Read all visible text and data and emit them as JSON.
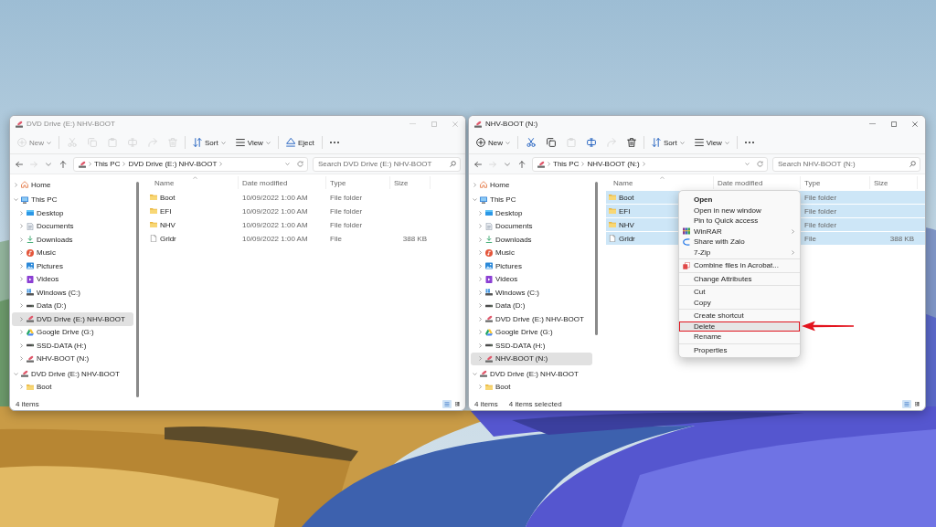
{
  "windows": [
    {
      "title": "DVD Drive (E:) NHV-BOOT",
      "active": false,
      "toolbar": {
        "groups": [
          [
            {
              "kind": "new",
              "label": "New",
              "dropdown": true,
              "disabled": true
            }
          ],
          [
            {
              "kind": "cut",
              "dropdown": false,
              "disabled": true
            },
            {
              "kind": "copy",
              "dropdown": false,
              "disabled": true
            },
            {
              "kind": "paste",
              "dropdown": false,
              "disabled": true
            },
            {
              "kind": "rename",
              "dropdown": false,
              "disabled": true
            },
            {
              "kind": "share",
              "dropdown": false,
              "disabled": true
            },
            {
              "kind": "delete",
              "dropdown": false,
              "disabled": true
            }
          ],
          [
            {
              "kind": "sort",
              "label": "Sort",
              "dropdown": true,
              "disabled": false
            },
            {
              "kind": "view",
              "label": "View",
              "dropdown": true,
              "disabled": false
            }
          ],
          [
            {
              "kind": "eject",
              "label": "Eject",
              "dropdown": false,
              "disabled": false
            }
          ],
          [
            {
              "kind": "more",
              "dropdown": false,
              "disabled": false
            }
          ]
        ]
      },
      "navigation": [
        {
          "kind": "back",
          "disabled": false
        },
        {
          "kind": "forward",
          "disabled": true
        },
        {
          "kind": "recent",
          "disabled": false
        },
        {
          "kind": "up",
          "disabled": false
        }
      ],
      "address": {
        "crumbs": [
          "This PC",
          "DVD Drive (E:) NHV-BOOT"
        ]
      },
      "search": {
        "placeholder": "Search DVD Drive (E:) NHV-BOOT"
      },
      "sidebar": {
        "items": [
          {
            "kind": "home",
            "label": "Home",
            "expanded": false,
            "selected": false
          },
          {
            "kind": "pc",
            "label": "This PC",
            "expanded": true,
            "selected": false,
            "children": [
              {
                "kind": "desktop",
                "label": "Desktop",
                "expanded": false,
                "selected": false
              },
              {
                "kind": "documents",
                "label": "Documents",
                "expanded": false,
                "selected": false
              },
              {
                "kind": "downloads",
                "label": "Downloads",
                "expanded": false,
                "selected": false
              },
              {
                "kind": "music",
                "label": "Music",
                "expanded": false,
                "selected": false
              },
              {
                "kind": "pictures",
                "label": "Pictures",
                "expanded": false,
                "selected": false
              },
              {
                "kind": "videos",
                "label": "Videos",
                "expanded": false,
                "selected": false
              },
              {
                "kind": "system",
                "label": "Windows (C:)",
                "expanded": false,
                "selected": false
              },
              {
                "kind": "drive",
                "label": "Data (D:)",
                "expanded": false,
                "selected": false
              },
              {
                "kind": "disc",
                "label": "DVD Drive (E:) NHV-BOOT",
                "expanded": false,
                "selected": true
              },
              {
                "kind": "cloud",
                "label": "Google Drive (G:)",
                "expanded": false,
                "selected": false
              },
              {
                "kind": "drive",
                "label": "SSD-DATA (H:)",
                "expanded": false,
                "selected": false
              },
              {
                "kind": "disc",
                "label": "NHV-BOOT (N:)",
                "expanded": false,
                "selected": false
              }
            ]
          },
          {
            "kind": "disc",
            "label": "DVD Drive (E:) NHV-BOOT",
            "expanded": true,
            "selected": false,
            "children": [
              {
                "kind": "folder",
                "label": "Boot",
                "expanded": false,
                "selected": false
              }
            ]
          }
        ]
      },
      "table": {
        "columns": [
          {
            "label": "Name",
            "sorted": true
          },
          {
            "label": "Date modified",
            "sorted": false
          },
          {
            "label": "Type",
            "sorted": false
          },
          {
            "label": "Size",
            "sorted": false
          }
        ],
        "rows": [
          {
            "kind": "folder",
            "name": "Boot",
            "date_modified": "10/09/2022 1:00 AM",
            "type": "File folder",
            "selected": false
          },
          {
            "kind": "folder",
            "name": "EFI",
            "date_modified": "10/09/2022 1:00 AM",
            "type": "File folder",
            "selected": false
          },
          {
            "kind": "folder",
            "name": "NHV",
            "date_modified": "10/09/2022 1:00 AM",
            "type": "File folder",
            "selected": false
          },
          {
            "kind": "file",
            "name": "Grldr",
            "date_modified": "10/09/2022 1:00 AM",
            "type": "File",
            "size": "388 KB",
            "selected": false
          }
        ]
      },
      "status_bar": {
        "texts": [
          "4 items"
        ],
        "view_modes": [
          {
            "kind": "details",
            "selected": true
          },
          {
            "kind": "tiles",
            "selected": false
          }
        ]
      }
    },
    {
      "title": "NHV-BOOT (N:)",
      "active": true,
      "toolbar": {
        "groups": [
          [
            {
              "kind": "new",
              "label": "New",
              "dropdown": true,
              "disabled": false
            }
          ],
          [
            {
              "kind": "cut",
              "dropdown": false,
              "disabled": false
            },
            {
              "kind": "copy",
              "dropdown": false,
              "disabled": false
            },
            {
              "kind": "paste",
              "dropdown": false,
              "disabled": true
            },
            {
              "kind": "rename",
              "dropdown": false,
              "disabled": false
            },
            {
              "kind": "share",
              "dropdown": false,
              "disabled": true
            },
            {
              "kind": "delete",
              "dropdown": false,
              "disabled": false
            }
          ],
          [
            {
              "kind": "sort",
              "label": "Sort",
              "dropdown": true,
              "disabled": false
            },
            {
              "kind": "view",
              "label": "View",
              "dropdown": true,
              "disabled": false
            }
          ],
          [
            {
              "kind": "more",
              "dropdown": false,
              "disabled": false
            }
          ]
        ]
      },
      "navigation": [
        {
          "kind": "back",
          "disabled": false
        },
        {
          "kind": "forward",
          "disabled": true
        },
        {
          "kind": "recent",
          "disabled": false
        },
        {
          "kind": "up",
          "disabled": false
        }
      ],
      "address": {
        "crumbs": [
          "This PC",
          "NHV-BOOT (N:)"
        ]
      },
      "search": {
        "placeholder": "Search NHV-BOOT (N:)"
      },
      "sidebar": {
        "items": [
          {
            "kind": "home",
            "label": "Home",
            "expanded": false,
            "selected": false
          },
          {
            "kind": "pc",
            "label": "This PC",
            "expanded": true,
            "selected": false,
            "children": [
              {
                "kind": "desktop",
                "label": "Desktop",
                "expanded": false,
                "selected": false
              },
              {
                "kind": "documents",
                "label": "Documents",
                "expanded": false,
                "selected": false
              },
              {
                "kind": "downloads",
                "label": "Downloads",
                "expanded": false,
                "selected": false
              },
              {
                "kind": "music",
                "label": "Music",
                "expanded": false,
                "selected": false
              },
              {
                "kind": "pictures",
                "label": "Pictures",
                "expanded": false,
                "selected": false
              },
              {
                "kind": "videos",
                "label": "Videos",
                "expanded": false,
                "selected": false
              },
              {
                "kind": "system",
                "label": "Windows (C:)",
                "expanded": false,
                "selected": false
              },
              {
                "kind": "drive",
                "label": "Data (D:)",
                "expanded": false,
                "selected": false
              },
              {
                "kind": "disc",
                "label": "DVD Drive (E:) NHV-BOOT",
                "expanded": false,
                "selected": false
              },
              {
                "kind": "cloud",
                "label": "Google Drive (G:)",
                "expanded": false,
                "selected": false
              },
              {
                "kind": "drive",
                "label": "SSD-DATA (H:)",
                "expanded": false,
                "selected": false
              },
              {
                "kind": "disc",
                "label": "NHV-BOOT (N:)",
                "expanded": false,
                "selected": true
              }
            ]
          },
          {
            "kind": "disc",
            "label": "DVD Drive (E:) NHV-BOOT",
            "expanded": true,
            "selected": false,
            "children": [
              {
                "kind": "folder",
                "label": "Boot",
                "expanded": false,
                "selected": false
              }
            ]
          }
        ]
      },
      "table": {
        "columns": [
          {
            "label": "Name",
            "sorted": true
          },
          {
            "label": "Date modified",
            "sorted": false
          },
          {
            "label": "Type",
            "sorted": false
          },
          {
            "label": "Size",
            "sorted": false
          }
        ],
        "rows": [
          {
            "kind": "folder",
            "name": "Boot",
            "type": "File folder",
            "selected": true
          },
          {
            "kind": "folder",
            "name": "EFI",
            "type": "File folder",
            "selected": true
          },
          {
            "kind": "folder",
            "name": "NHV",
            "type": "File folder",
            "selected": true
          },
          {
            "kind": "file",
            "name": "Grldr",
            "type": "File",
            "size": "388 KB",
            "selected": true
          }
        ]
      },
      "status_bar": {
        "texts": [
          "4 items",
          "4 items selected"
        ],
        "view_modes": [
          {
            "kind": "details",
            "selected": true
          },
          {
            "kind": "tiles",
            "selected": false
          }
        ]
      },
      "context_menu": {
        "groups": [
          [
            {
              "kind": "plain",
              "label": "Open",
              "default": true,
              "submenu": false,
              "highlighted": false
            },
            {
              "kind": "plain",
              "label": "Open in new window",
              "default": false,
              "submenu": false,
              "highlighted": false
            },
            {
              "kind": "plain",
              "label": "Pin to Quick access",
              "default": false,
              "submenu": false,
              "highlighted": false
            },
            {
              "kind": "archive",
              "label": "WinRAR",
              "default": false,
              "submenu": true,
              "highlighted": false
            },
            {
              "kind": "share",
              "label": "Share with Zalo",
              "default": false,
              "submenu": false,
              "highlighted": false
            },
            {
              "kind": "plain",
              "label": "7-Zip",
              "default": false,
              "submenu": true,
              "highlighted": false
            }
          ],
          [
            {
              "kind": "pdf",
              "label": "Combine files in Acrobat...",
              "default": false,
              "submenu": false,
              "highlighted": false
            }
          ],
          [
            {
              "kind": "plain",
              "label": "Change Attributes",
              "default": false,
              "submenu": false,
              "highlighted": false
            }
          ],
          [
            {
              "kind": "plain",
              "label": "Cut",
              "default": false,
              "submenu": false,
              "highlighted": false
            },
            {
              "kind": "plain",
              "label": "Copy",
              "default": false,
              "submenu": false,
              "highlighted": false
            }
          ],
          [
            {
              "kind": "plain",
              "label": "Create shortcut",
              "default": false,
              "submenu": false,
              "highlighted": false
            },
            {
              "kind": "plain",
              "label": "Delete",
              "default": false,
              "submenu": false,
              "highlighted": true
            },
            {
              "kind": "plain",
              "label": "Rename",
              "default": false,
              "submenu": false,
              "highlighted": false
            }
          ],
          [
            {
              "kind": "plain",
              "label": "Properties",
              "default": false,
              "submenu": false,
              "highlighted": false
            }
          ]
        ]
      }
    }
  ]
}
